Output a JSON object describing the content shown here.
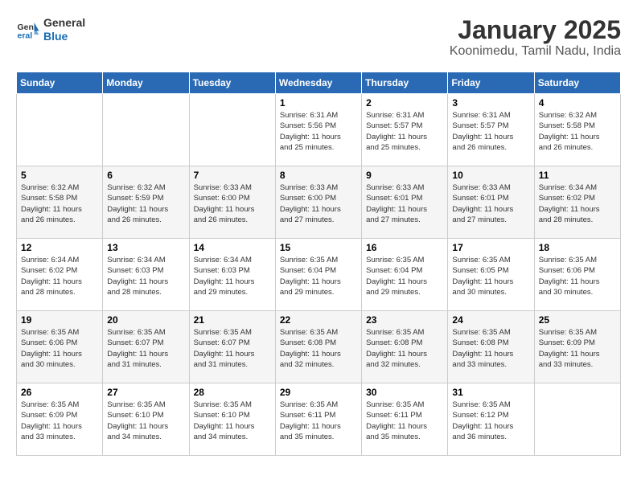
{
  "header": {
    "logo": {
      "general": "General",
      "blue": "Blue"
    },
    "title": "January 2025",
    "location": "Koonimedu, Tamil Nadu, India"
  },
  "weekdays": [
    "Sunday",
    "Monday",
    "Tuesday",
    "Wednesday",
    "Thursday",
    "Friday",
    "Saturday"
  ],
  "weeks": [
    [
      {
        "day": null,
        "info": null
      },
      {
        "day": null,
        "info": null
      },
      {
        "day": null,
        "info": null
      },
      {
        "day": "1",
        "info": "Sunrise: 6:31 AM\nSunset: 5:56 PM\nDaylight: 11 hours\nand 25 minutes."
      },
      {
        "day": "2",
        "info": "Sunrise: 6:31 AM\nSunset: 5:57 PM\nDaylight: 11 hours\nand 25 minutes."
      },
      {
        "day": "3",
        "info": "Sunrise: 6:31 AM\nSunset: 5:57 PM\nDaylight: 11 hours\nand 26 minutes."
      },
      {
        "day": "4",
        "info": "Sunrise: 6:32 AM\nSunset: 5:58 PM\nDaylight: 11 hours\nand 26 minutes."
      }
    ],
    [
      {
        "day": "5",
        "info": "Sunrise: 6:32 AM\nSunset: 5:58 PM\nDaylight: 11 hours\nand 26 minutes."
      },
      {
        "day": "6",
        "info": "Sunrise: 6:32 AM\nSunset: 5:59 PM\nDaylight: 11 hours\nand 26 minutes."
      },
      {
        "day": "7",
        "info": "Sunrise: 6:33 AM\nSunset: 6:00 PM\nDaylight: 11 hours\nand 26 minutes."
      },
      {
        "day": "8",
        "info": "Sunrise: 6:33 AM\nSunset: 6:00 PM\nDaylight: 11 hours\nand 27 minutes."
      },
      {
        "day": "9",
        "info": "Sunrise: 6:33 AM\nSunset: 6:01 PM\nDaylight: 11 hours\nand 27 minutes."
      },
      {
        "day": "10",
        "info": "Sunrise: 6:33 AM\nSunset: 6:01 PM\nDaylight: 11 hours\nand 27 minutes."
      },
      {
        "day": "11",
        "info": "Sunrise: 6:34 AM\nSunset: 6:02 PM\nDaylight: 11 hours\nand 28 minutes."
      }
    ],
    [
      {
        "day": "12",
        "info": "Sunrise: 6:34 AM\nSunset: 6:02 PM\nDaylight: 11 hours\nand 28 minutes."
      },
      {
        "day": "13",
        "info": "Sunrise: 6:34 AM\nSunset: 6:03 PM\nDaylight: 11 hours\nand 28 minutes."
      },
      {
        "day": "14",
        "info": "Sunrise: 6:34 AM\nSunset: 6:03 PM\nDaylight: 11 hours\nand 29 minutes."
      },
      {
        "day": "15",
        "info": "Sunrise: 6:35 AM\nSunset: 6:04 PM\nDaylight: 11 hours\nand 29 minutes."
      },
      {
        "day": "16",
        "info": "Sunrise: 6:35 AM\nSunset: 6:04 PM\nDaylight: 11 hours\nand 29 minutes."
      },
      {
        "day": "17",
        "info": "Sunrise: 6:35 AM\nSunset: 6:05 PM\nDaylight: 11 hours\nand 30 minutes."
      },
      {
        "day": "18",
        "info": "Sunrise: 6:35 AM\nSunset: 6:06 PM\nDaylight: 11 hours\nand 30 minutes."
      }
    ],
    [
      {
        "day": "19",
        "info": "Sunrise: 6:35 AM\nSunset: 6:06 PM\nDaylight: 11 hours\nand 30 minutes."
      },
      {
        "day": "20",
        "info": "Sunrise: 6:35 AM\nSunset: 6:07 PM\nDaylight: 11 hours\nand 31 minutes."
      },
      {
        "day": "21",
        "info": "Sunrise: 6:35 AM\nSunset: 6:07 PM\nDaylight: 11 hours\nand 31 minutes."
      },
      {
        "day": "22",
        "info": "Sunrise: 6:35 AM\nSunset: 6:08 PM\nDaylight: 11 hours\nand 32 minutes."
      },
      {
        "day": "23",
        "info": "Sunrise: 6:35 AM\nSunset: 6:08 PM\nDaylight: 11 hours\nand 32 minutes."
      },
      {
        "day": "24",
        "info": "Sunrise: 6:35 AM\nSunset: 6:08 PM\nDaylight: 11 hours\nand 33 minutes."
      },
      {
        "day": "25",
        "info": "Sunrise: 6:35 AM\nSunset: 6:09 PM\nDaylight: 11 hours\nand 33 minutes."
      }
    ],
    [
      {
        "day": "26",
        "info": "Sunrise: 6:35 AM\nSunset: 6:09 PM\nDaylight: 11 hours\nand 33 minutes."
      },
      {
        "day": "27",
        "info": "Sunrise: 6:35 AM\nSunset: 6:10 PM\nDaylight: 11 hours\nand 34 minutes."
      },
      {
        "day": "28",
        "info": "Sunrise: 6:35 AM\nSunset: 6:10 PM\nDaylight: 11 hours\nand 34 minutes."
      },
      {
        "day": "29",
        "info": "Sunrise: 6:35 AM\nSunset: 6:11 PM\nDaylight: 11 hours\nand 35 minutes."
      },
      {
        "day": "30",
        "info": "Sunrise: 6:35 AM\nSunset: 6:11 PM\nDaylight: 11 hours\nand 35 minutes."
      },
      {
        "day": "31",
        "info": "Sunrise: 6:35 AM\nSunset: 6:12 PM\nDaylight: 11 hours\nand 36 minutes."
      },
      {
        "day": null,
        "info": null
      }
    ]
  ]
}
